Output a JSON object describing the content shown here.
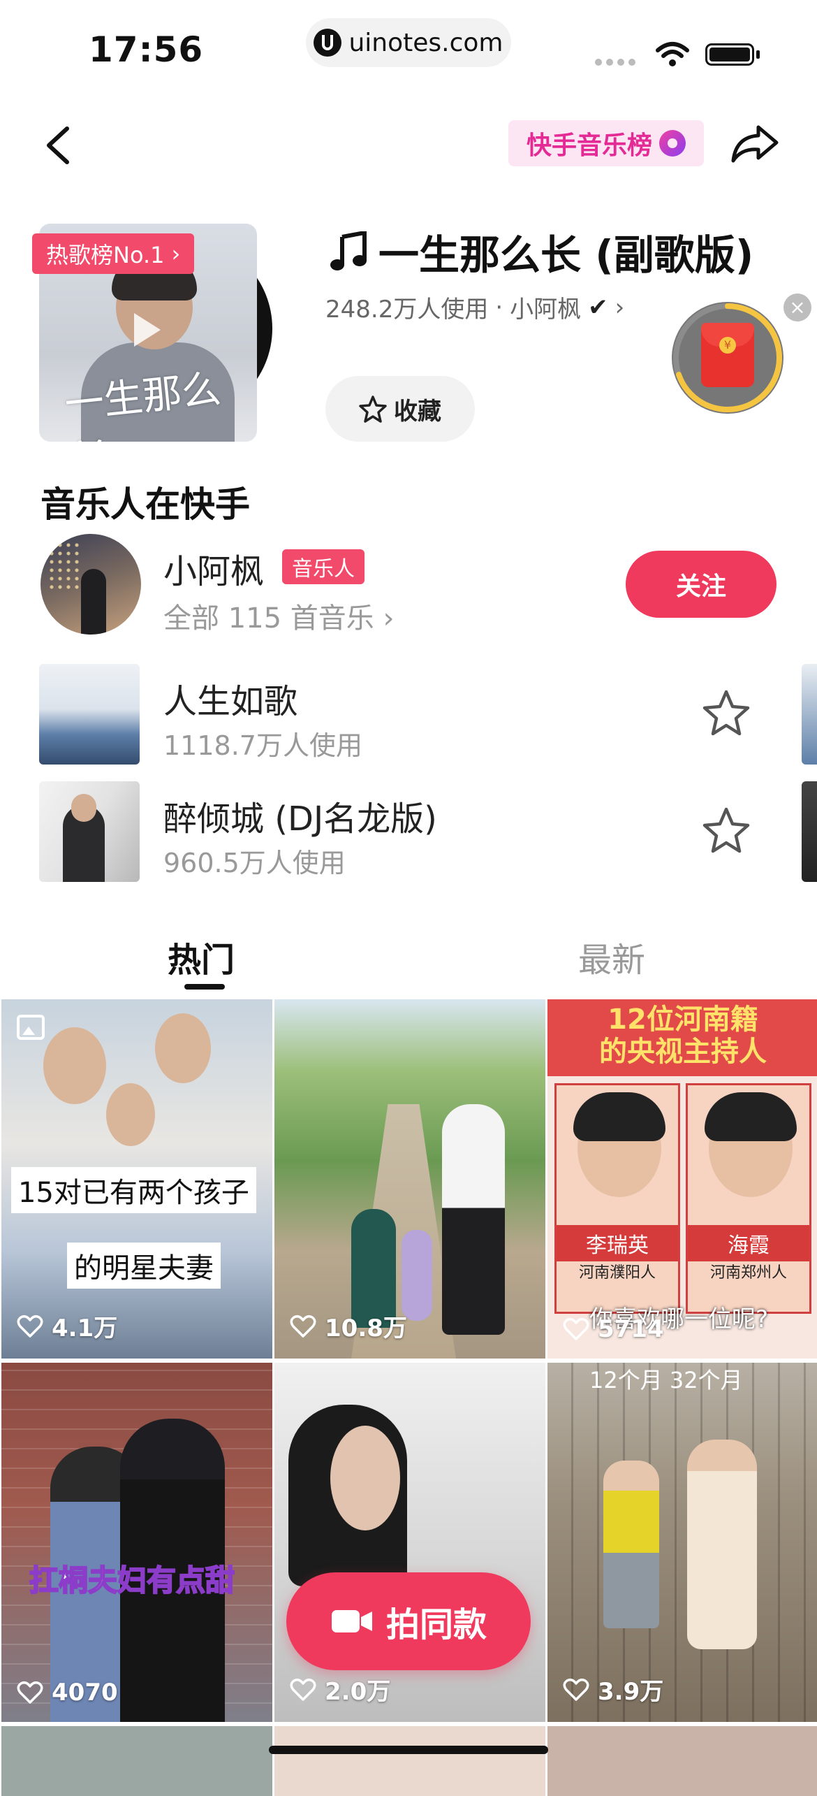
{
  "status_bar": {
    "time": "17:56",
    "url": "uinotes.com"
  },
  "nav": {
    "chart_badge": "快手音乐榜"
  },
  "song": {
    "hot_tag": "热歌榜No.1",
    "title": "一生那么长 (副歌版)",
    "uses": "248.2万人使用",
    "artist": "小阿枫",
    "favorite_label": "收藏",
    "cover_text": "一生那么长"
  },
  "musician_section": {
    "title": "音乐人在快手",
    "name": "小阿枫",
    "tag": "音乐人",
    "subtitle": "全部 115 首音乐",
    "follow_label": "关注"
  },
  "song_list": [
    {
      "name": "人生如歌",
      "uses": "1118.7万人使用"
    },
    {
      "name": "醉倾城 (DJ名龙版)",
      "uses": "960.5万人使用"
    }
  ],
  "tabs": {
    "hot": "热门",
    "latest": "最新"
  },
  "grid": [
    {
      "likes": "4.1万",
      "caption1": "15对已有两个孩子",
      "caption2": "的明星夫妻"
    },
    {
      "likes": "10.8万"
    },
    {
      "likes": "5714",
      "header1": "12位河南籍",
      "header2": "的央视主持人",
      "name1": "李瑞英",
      "city1": "河南濮阳人",
      "name2": "海霞",
      "city2": "河南郑州人",
      "question": "你喜欢哪一位呢?"
    },
    {
      "likes": "4070",
      "overlay": "扛桐夫妇有点甜"
    },
    {
      "likes": "2.0万"
    },
    {
      "likes": "3.9万",
      "label": "12个月   32个月"
    }
  ],
  "shoot_button": "拍同款",
  "colors": {
    "accent": "#ef3a5d",
    "tag": "#f24a6a",
    "chart_pink": "#e42a95"
  }
}
